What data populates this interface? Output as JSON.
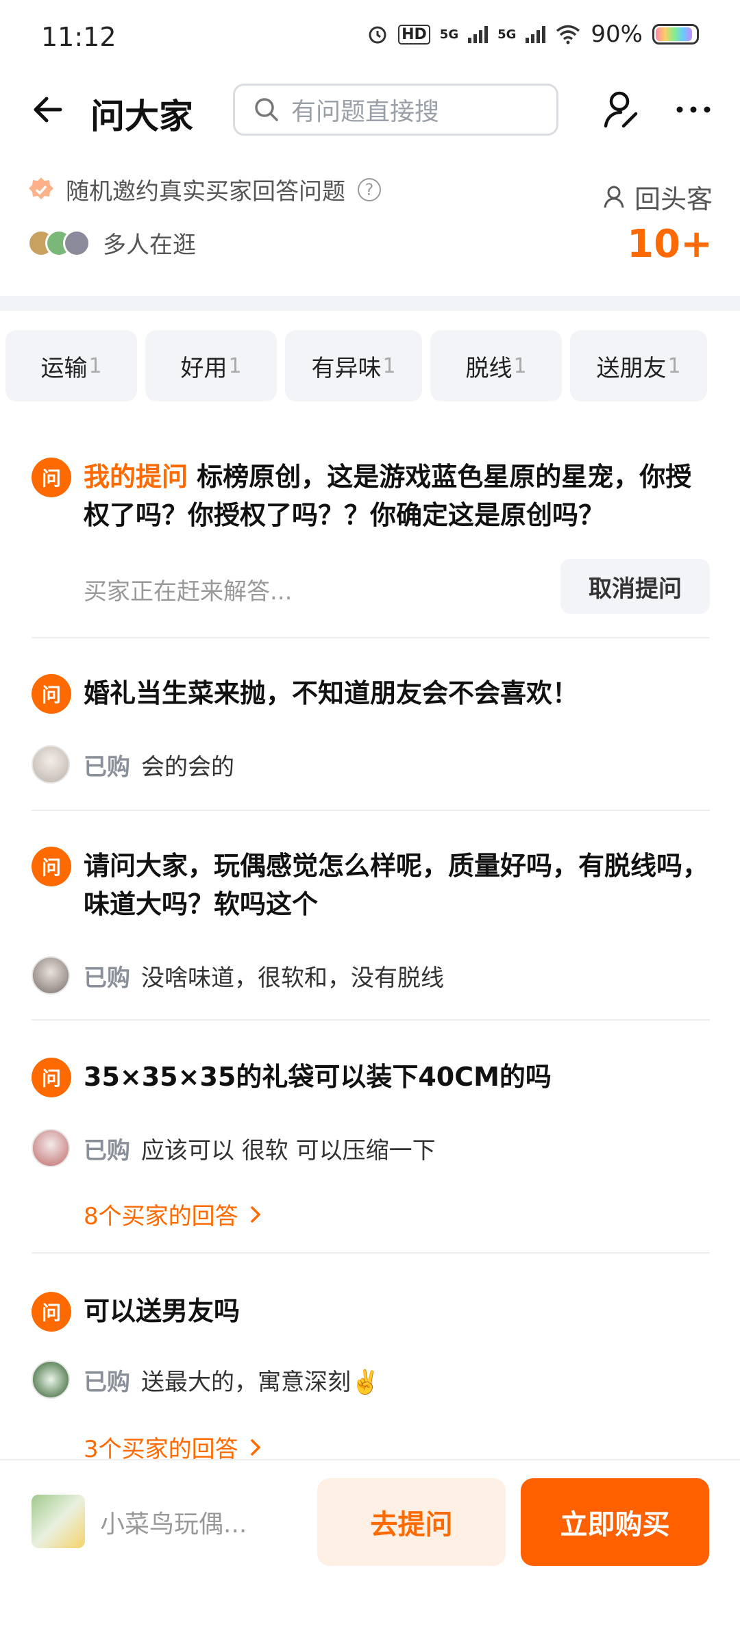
{
  "status_bar": {
    "time": "11:12",
    "battery": "90%",
    "net1": "5G",
    "net2": "5G",
    "hd": "HD"
  },
  "header": {
    "title": "问大家",
    "search_placeholder": "有问题直接搜"
  },
  "invite": {
    "text": "随机邀约真实买家回答问题",
    "browsing": "多人在逛",
    "returning_label": "回头客",
    "returning_count": "10+"
  },
  "tags": [
    {
      "label": "运输",
      "count": "1"
    },
    {
      "label": "好用",
      "count": "1"
    },
    {
      "label": "有异味",
      "count": "1"
    },
    {
      "label": "脱线",
      "count": "1"
    },
    {
      "label": "送朋友",
      "count": "1"
    }
  ],
  "q_icon": "问",
  "my_question": {
    "prefix": "我的提问",
    "text": "标榜原创，这是游戏蓝色星原的星宠，你授权了吗？你授权了吗？？你确定这是原创吗？",
    "pending": "买家正在赶来解答...",
    "cancel": "取消提问"
  },
  "bought_label": "已购",
  "questions": [
    {
      "text": "婚礼当生菜来抛，不知道朋友会不会喜欢！",
      "answer": "会的会的"
    },
    {
      "text": "请问大家，玩偶感觉怎么样呢，质量好吗，有脱线吗，味道大吗？软吗这个",
      "answer": "没啥味道，很软和，没有脱线"
    },
    {
      "text": "35×35×35的礼袋可以装下40CM的吗",
      "answer": "应该可以 很软 可以压缩一下",
      "more": "8个买家的回答"
    },
    {
      "text": "可以送男友吗",
      "answer": "送最大的，寓意深刻✌️",
      "more": "3个买家的回答"
    }
  ],
  "bottom": {
    "product_name": "小菜鸟玩偶...",
    "ask": "去提问",
    "buy": "立即购买"
  }
}
